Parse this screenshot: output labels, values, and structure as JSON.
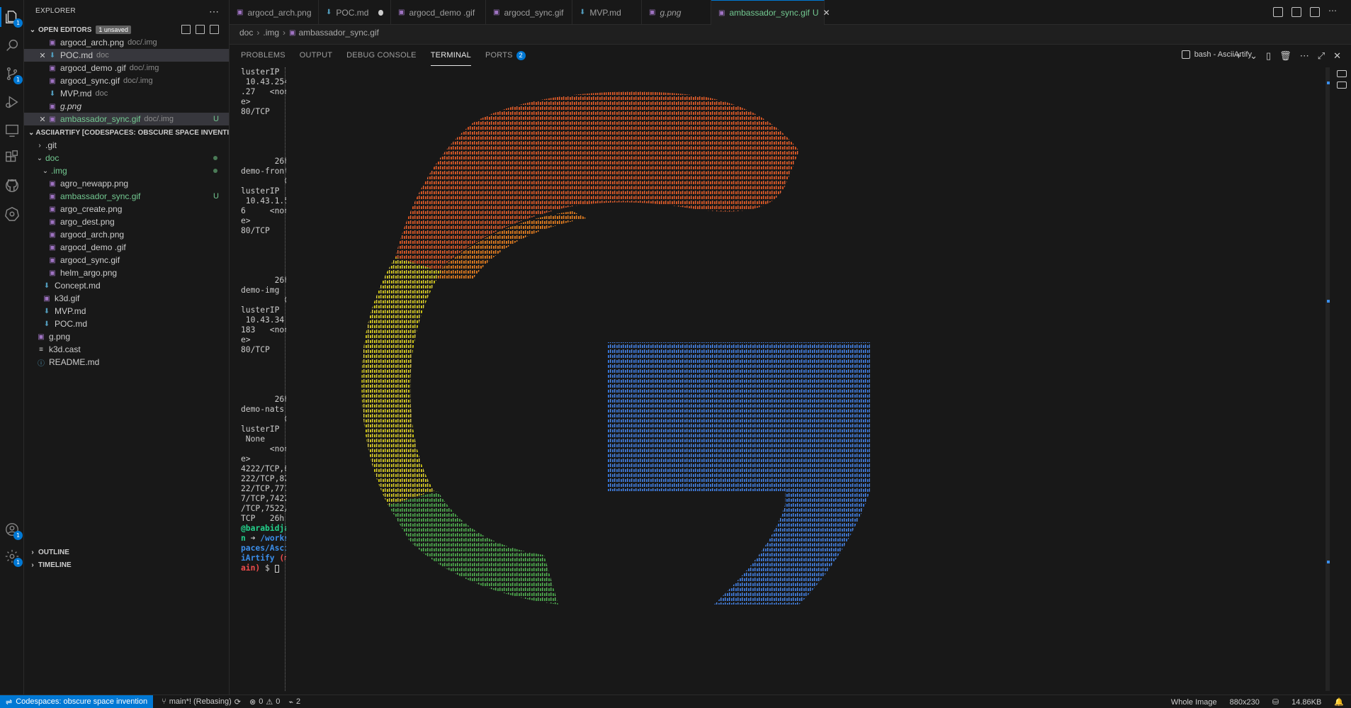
{
  "activity_bar": {
    "items": [
      {
        "name": "explorer-icon",
        "badge": "1"
      },
      {
        "name": "search-icon",
        "badge": ""
      },
      {
        "name": "source-control-icon",
        "badge": "1"
      },
      {
        "name": "run-debug-icon",
        "badge": ""
      },
      {
        "name": "remote-explorer-icon",
        "badge": ""
      },
      {
        "name": "extensions-icon",
        "badge": ""
      },
      {
        "name": "github-icon",
        "badge": ""
      },
      {
        "name": "kubernetes-icon",
        "badge": ""
      }
    ],
    "bottom": [
      {
        "name": "accounts-icon",
        "badge": "1"
      },
      {
        "name": "settings-gear-icon",
        "badge": "1"
      }
    ]
  },
  "sidebar": {
    "title": "EXPLORER",
    "open_editors": {
      "title": "OPEN EDITORS",
      "badge": "1 unsaved",
      "items": [
        {
          "name": "argocd_arch.png",
          "dir": "doc/.img",
          "icon": "img",
          "close": false,
          "italic": false,
          "selected": false,
          "status": ""
        },
        {
          "name": "POC.md",
          "dir": "doc",
          "icon": "md",
          "close": true,
          "italic": false,
          "selected": true,
          "status": ""
        },
        {
          "name": "argocd_demo .gif",
          "dir": "doc/.img",
          "icon": "img",
          "close": false,
          "italic": false,
          "selected": false,
          "status": ""
        },
        {
          "name": "argocd_sync.gif",
          "dir": "doc/.img",
          "icon": "img",
          "close": false,
          "italic": false,
          "selected": false,
          "status": ""
        },
        {
          "name": "MVP.md",
          "dir": "doc",
          "icon": "md",
          "close": false,
          "italic": false,
          "selected": false,
          "status": ""
        },
        {
          "name": "g.png",
          "dir": "",
          "icon": "img",
          "close": false,
          "italic": true,
          "selected": false,
          "status": ""
        },
        {
          "name": "ambassador_sync.gif",
          "dir": "doc/.img",
          "icon": "img",
          "close": true,
          "italic": false,
          "selected": true,
          "status": "U"
        }
      ]
    },
    "workspace": {
      "title": "ASCIIARTIFY [CODESPACES: OBSCURE SPACE INVENTION]",
      "items": [
        {
          "name": ".git",
          "indent": 1,
          "type": "folder-closed",
          "status": "",
          "dot": false,
          "untracked": false
        },
        {
          "name": "doc",
          "indent": 1,
          "type": "folder-open",
          "status": "",
          "dot": true,
          "untracked": true
        },
        {
          "name": ".img",
          "indent": 2,
          "type": "folder-open",
          "status": "",
          "dot": true,
          "untracked": true
        },
        {
          "name": "agro_newapp.png",
          "indent": 3,
          "type": "img",
          "status": "",
          "dot": false,
          "untracked": false
        },
        {
          "name": "ambassador_sync.gif",
          "indent": 3,
          "type": "img",
          "status": "U",
          "dot": false,
          "untracked": true
        },
        {
          "name": "argo_create.png",
          "indent": 3,
          "type": "img",
          "status": "",
          "dot": false,
          "untracked": false
        },
        {
          "name": "argo_dest.png",
          "indent": 3,
          "type": "img",
          "status": "",
          "dot": false,
          "untracked": false
        },
        {
          "name": "argocd_arch.png",
          "indent": 3,
          "type": "img",
          "status": "",
          "dot": false,
          "untracked": false
        },
        {
          "name": "argocd_demo .gif",
          "indent": 3,
          "type": "img",
          "status": "",
          "dot": false,
          "untracked": false
        },
        {
          "name": "argocd_sync.gif",
          "indent": 3,
          "type": "img",
          "status": "",
          "dot": false,
          "untracked": false
        },
        {
          "name": "helm_argo.png",
          "indent": 3,
          "type": "img",
          "status": "",
          "dot": false,
          "untracked": false
        },
        {
          "name": "Concept.md",
          "indent": 2,
          "type": "md",
          "status": "",
          "dot": false,
          "untracked": false
        },
        {
          "name": "k3d.gif",
          "indent": 2,
          "type": "img",
          "status": "",
          "dot": false,
          "untracked": false
        },
        {
          "name": "MVP.md",
          "indent": 2,
          "type": "md",
          "status": "",
          "dot": false,
          "untracked": false
        },
        {
          "name": "POC.md",
          "indent": 2,
          "type": "md",
          "status": "",
          "dot": false,
          "untracked": false
        },
        {
          "name": "g.png",
          "indent": 1,
          "type": "img",
          "status": "",
          "dot": false,
          "untracked": false
        },
        {
          "name": "k3d.cast",
          "indent": 1,
          "type": "cast",
          "status": "",
          "dot": false,
          "untracked": false
        },
        {
          "name": "README.md",
          "indent": 1,
          "type": "info",
          "status": "",
          "dot": false,
          "untracked": false
        }
      ]
    },
    "outline_title": "OUTLINE",
    "timeline_title": "TIMELINE"
  },
  "tabs": [
    {
      "label": "argocd_arch.png",
      "icon": "img",
      "active": false,
      "dirty": false,
      "italic": false
    },
    {
      "label": "POC.md",
      "icon": "md",
      "active": false,
      "dirty": true,
      "italic": false
    },
    {
      "label": "argocd_demo .gif",
      "icon": "img",
      "active": false,
      "dirty": false,
      "italic": false
    },
    {
      "label": "argocd_sync.gif",
      "icon": "img",
      "active": false,
      "dirty": false,
      "italic": false
    },
    {
      "label": "MVP.md",
      "icon": "md",
      "active": false,
      "dirty": false,
      "italic": false
    },
    {
      "label": "g.png",
      "icon": "img",
      "active": false,
      "dirty": false,
      "italic": true
    },
    {
      "label": "ambassador_sync.gif",
      "icon": "img",
      "active": true,
      "dirty": false,
      "italic": false,
      "status": "U"
    }
  ],
  "breadcrumb": [
    "doc",
    ".img",
    "ambassador_sync.gif"
  ],
  "panel": {
    "tabs": [
      "PROBLEMS",
      "OUTPUT",
      "DEBUG CONSOLE",
      "TERMINAL",
      "PORTS"
    ],
    "active_tab": "TERMINAL",
    "ports_badge": "2",
    "terminal_name": "bash - AsciiArtify",
    "actions": [
      "+",
      "⌄",
      "▯",
      "🗑",
      "⋯",
      "⤢",
      "✕"
    ]
  },
  "terminal_lines": [
    "lusterIP",
    " 10.43.254",
    ".27   <non",
    "e>",
    "80/TCP",
    "",
    "",
    "",
    "",
    "       26h",
    "demo-front",
    "         C",
    "lusterIP",
    " 10.43.1.5",
    "6     <non",
    "e>",
    "80/TCP",
    "",
    "",
    "",
    "",
    "       26h",
    "demo-img",
    "         C",
    "lusterIP",
    " 10.43.34.",
    "183   <non",
    "e>",
    "80/TCP",
    "",
    "",
    "",
    "",
    "       26h",
    "demo-nats",
    "         C",
    "lusterIP",
    " None",
    "      <non",
    "e>",
    "4222/TCP,6",
    "222/TCP,82",
    "22/TCP,777",
    "7/TCP,7422",
    "/TCP,7522/",
    "TCP   26h"
  ],
  "prompt": {
    "user": "@barabidja",
    "user2": "n",
    "arrow": "➜",
    "path1": "/works",
    "path2": "paces/Asci",
    "path3": "iArtify",
    "branch_open": "(m",
    "branch_close": "ain)",
    "dollar": "$"
  },
  "statusbar": {
    "remote": "Codespaces: obscure space invention",
    "branch": "main*! (Rebasing)",
    "errors": "0",
    "warnings": "0",
    "ports": "2",
    "whole_image": "Whole Image",
    "dimensions": "880x230",
    "size": "14.86KB"
  },
  "colors": {
    "accent": "#0078d4",
    "untracked": "#73c991",
    "ascii_top": "#e07b1a",
    "ascii_left": "#c8c000",
    "ascii_bottom_left": "#5ab35a",
    "ascii_right": "#3b7ddd"
  }
}
